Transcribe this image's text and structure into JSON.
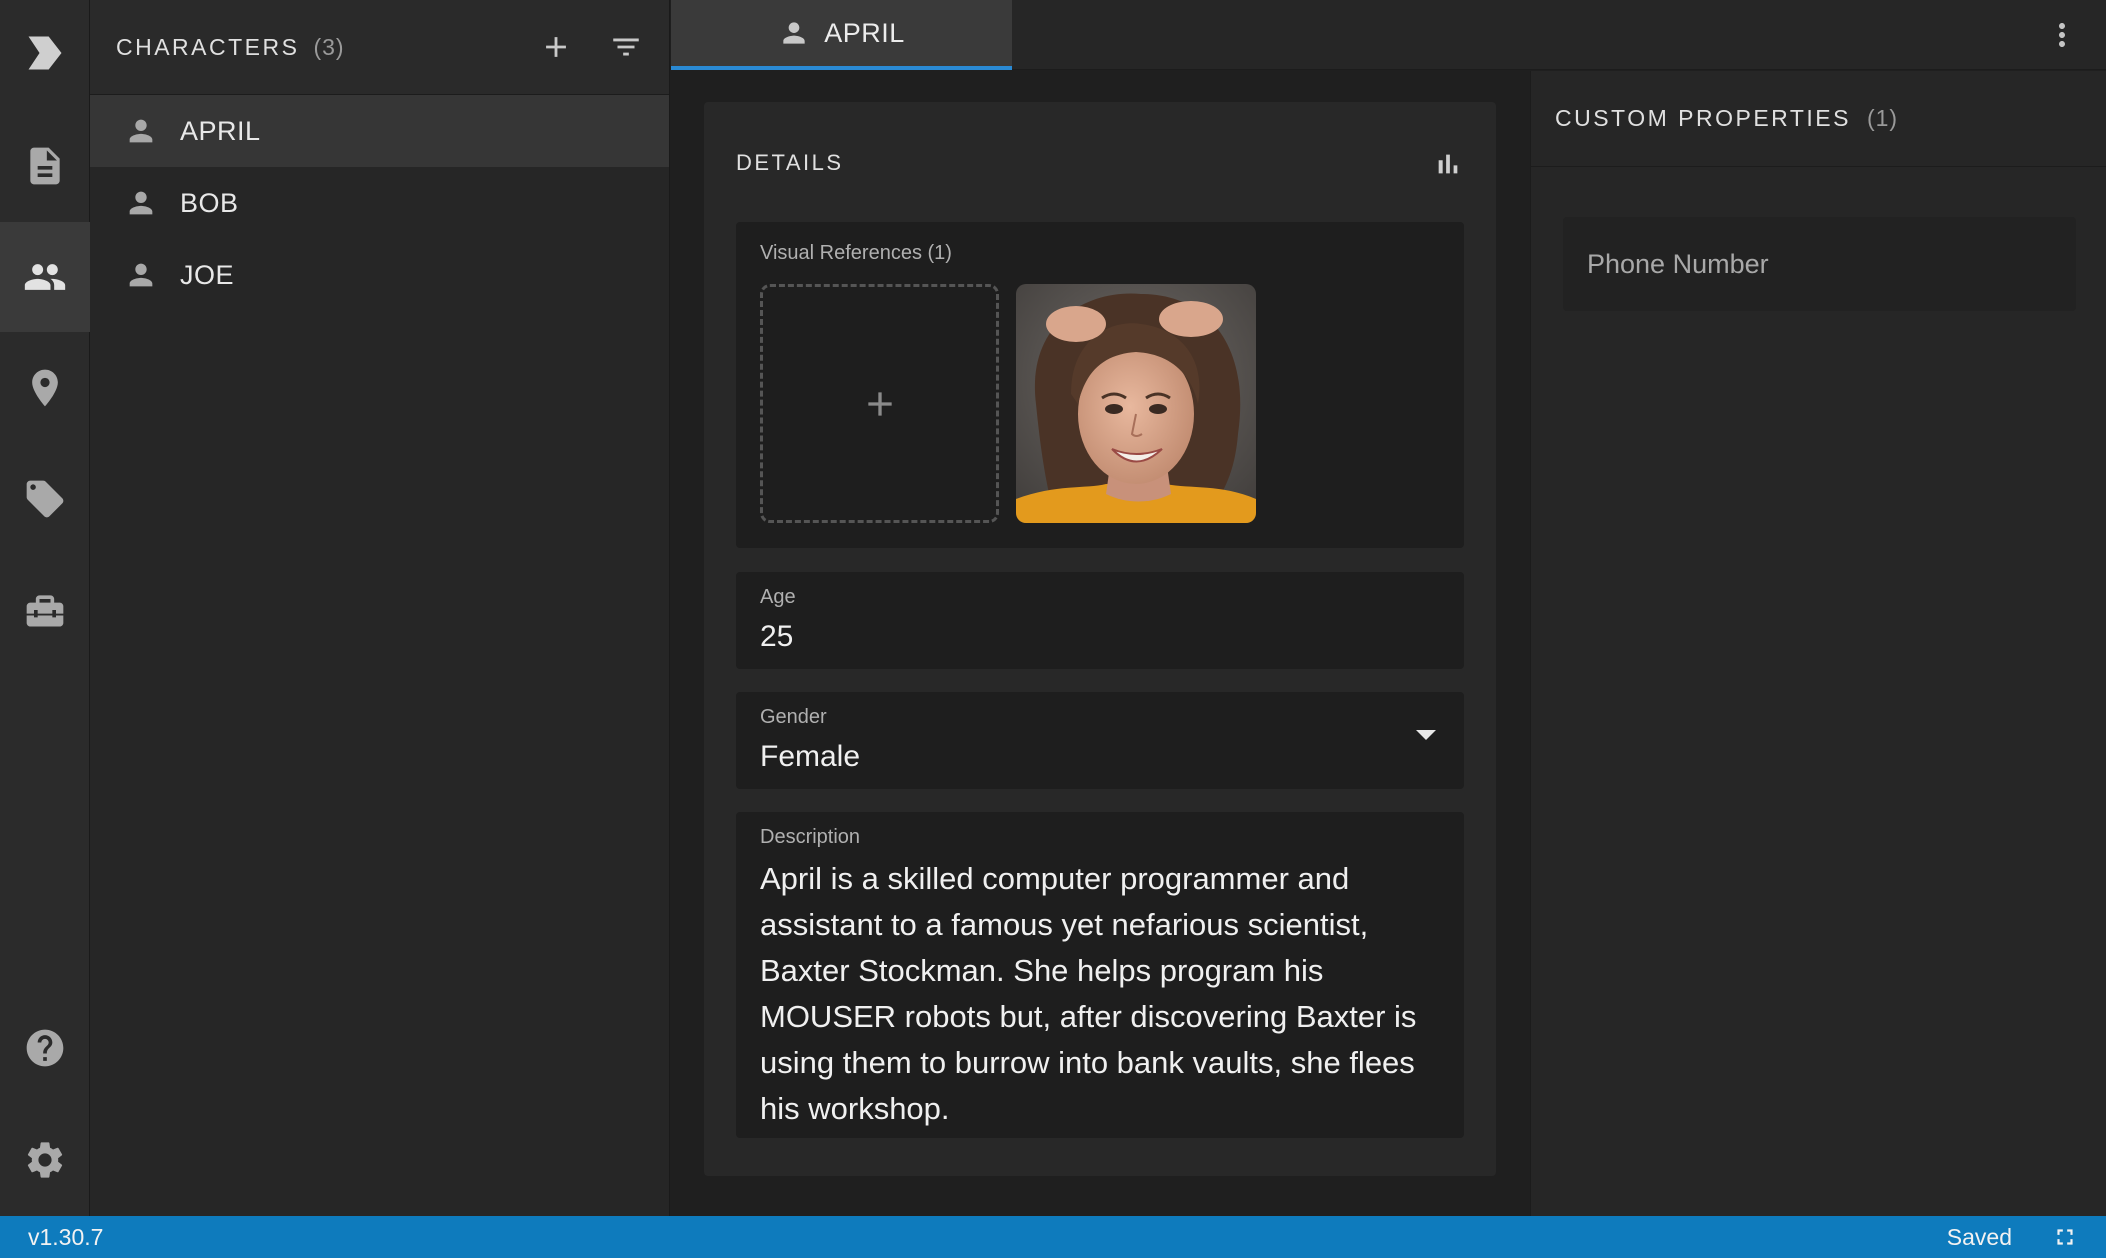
{
  "activity_bar": {
    "items": [
      {
        "name": "logo-icon"
      },
      {
        "name": "document-icon"
      },
      {
        "name": "characters-icon"
      },
      {
        "name": "location-pin-icon"
      },
      {
        "name": "tag-icon"
      },
      {
        "name": "toolbox-icon"
      },
      {
        "name": "help-icon"
      },
      {
        "name": "settings-icon"
      }
    ],
    "active": "characters-icon"
  },
  "sidebar": {
    "title": "CHARACTERS",
    "count": "(3)",
    "items": [
      {
        "label": "APRIL",
        "selected": true
      },
      {
        "label": "BOB",
        "selected": false
      },
      {
        "label": "JOE",
        "selected": false
      }
    ]
  },
  "tabs": [
    {
      "label": "APRIL",
      "active": true
    }
  ],
  "details": {
    "title": "DETAILS",
    "visual_references_label": "Visual References (1)",
    "age_label": "Age",
    "age_value": "25",
    "gender_label": "Gender",
    "gender_value": "Female",
    "description_label": "Description",
    "description_value": "April is a skilled computer programmer and assistant to a famous yet nefarious scientist, Baxter Stockman. She helps program his MOUSER robots but, after discovering Baxter is using them to burrow into bank vaults, she flees his workshop."
  },
  "custom_properties": {
    "title": "CUSTOM PROPERTIES",
    "count": "(1)",
    "field_placeholder": "Phone Number"
  },
  "status_bar": {
    "version": "v1.30.7",
    "save_status": "Saved"
  },
  "colors": {
    "accent": "#2a8ad4",
    "status_bar": "#0e7bbd"
  }
}
